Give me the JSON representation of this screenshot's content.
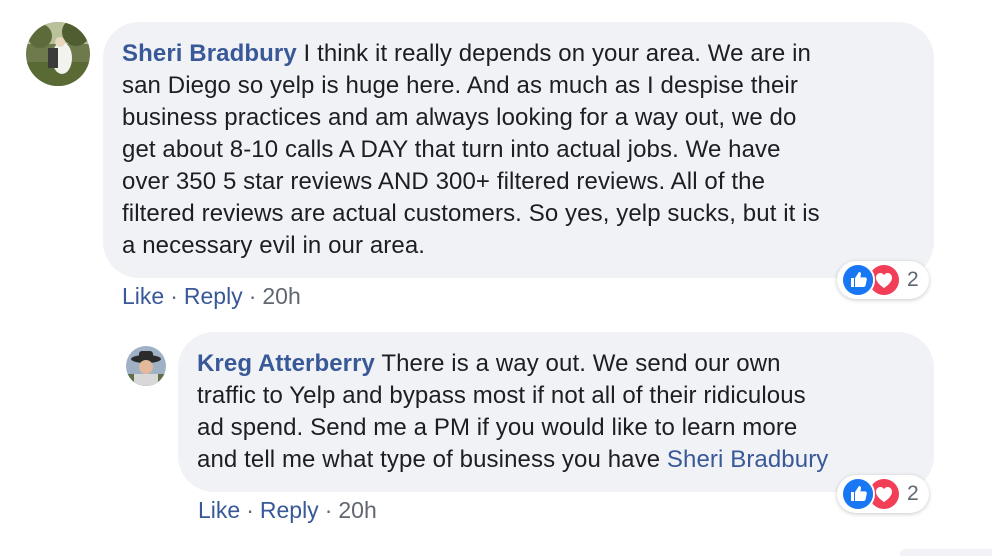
{
  "comments": [
    {
      "author": "Sheri Bradbury",
      "text_lines": [
        " I think it really depends on your area. We are in",
        "san Diego so yelp is huge here. And as much as I despise their",
        "business practices and am always looking for a way out, we do",
        "get about 8-10 calls A DAY that turn into actual jobs. We have",
        "over 350 5 star reviews AND 300+ filtered reviews. All of the",
        "filtered reviews are actual customers. So yes, yelp sucks, but it is",
        "a necessary evil in our area."
      ],
      "actions": {
        "like": "Like",
        "sep1": "·",
        "reply": "Reply",
        "sep2": "·",
        "time": "20h"
      },
      "reaction_count": "2",
      "reactions": [
        "like-icon",
        "love-icon"
      ]
    },
    {
      "author": "Kreg Atterberry",
      "text_lines": [
        " There is a way out. We send our own",
        "traffic to Yelp and bypass most if not all of their ridiculous",
        "ad spend. Send me a PM if you would like to learn more",
        "and tell me what type of business you have "
      ],
      "mention": "Sheri Bradbury",
      "actions": {
        "like": "Like",
        "sep1": "·",
        "reply": "Reply",
        "sep2": "·",
        "time": "20h"
      },
      "reaction_count": "2",
      "reactions": [
        "like-icon",
        "love-icon"
      ]
    }
  ],
  "colors": {
    "link": "#385898",
    "bubble": "#f0f2f5",
    "like": "#1877f2",
    "love": "#f33e58",
    "meta": "#606770"
  }
}
